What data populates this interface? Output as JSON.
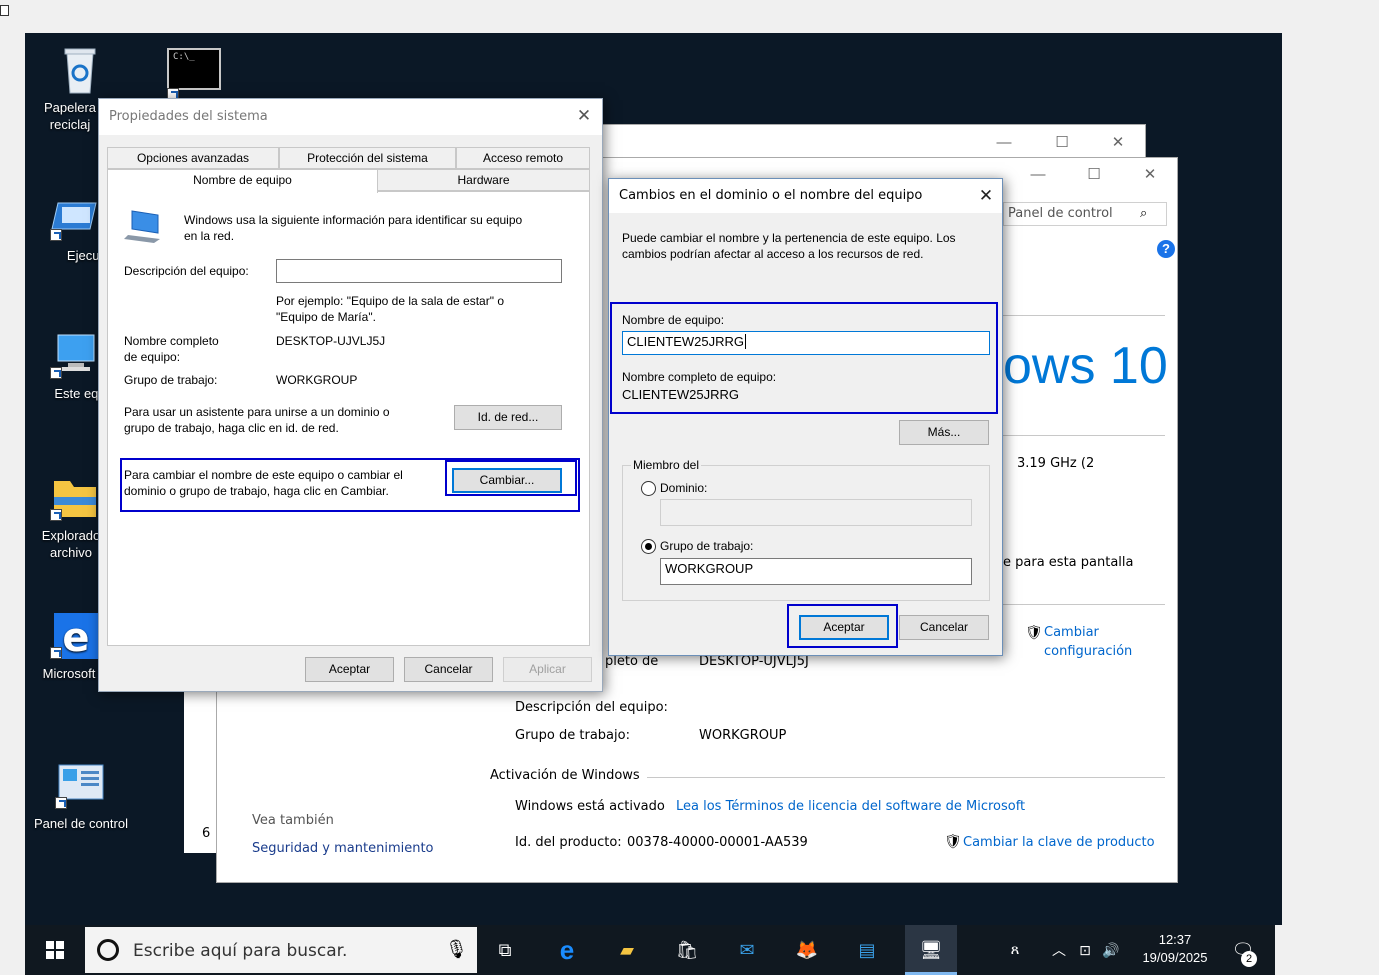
{
  "desktop": {
    "icons": [
      {
        "label": "Papelera de reciclaje",
        "line1": "Papelera",
        "line2": "reciclaj"
      },
      {
        "label": "Ejecutar",
        "line1": "Ejecut",
        "line2": ""
      },
      {
        "label": "Este equipo",
        "line1": "Este equ",
        "line2": ""
      },
      {
        "label": "Explorador de archivos",
        "line1": "Explorado",
        "line2": "archivo"
      },
      {
        "label": "Microsoft Edge",
        "line1": "Microsoft",
        "line2": ""
      },
      {
        "label": "Panel de control",
        "line1": "Panel de control",
        "line2": ""
      }
    ]
  },
  "sysinfo": {
    "search_placeholder": "Panel de control",
    "brand_text": "ows 10",
    "processor_fragment": "3.19 GHz  (2",
    "display_fragment": "e para esta pantalla",
    "change_settings": "Cambiar configuración",
    "change_settings_l1": "Cambiar",
    "change_settings_l2": "configuración",
    "full_name_label_fragment": "pleto de",
    "full_name_value": "DESKTOP-UJVLJ5J",
    "desc_label": "Descripción del equipo:",
    "workgroup_label": "Grupo de trabajo:",
    "workgroup_value": "WORKGROUP",
    "activation_header": "Activación de Windows",
    "activated_text": "Windows está activado",
    "license_link": "Lea los Términos de licencia del software de Microsoft",
    "product_id_label": "Id. del producto:",
    "product_id_value": "00378-40000-00001-AA539",
    "change_key": "Cambiar la clave de producto",
    "see_also": "Vea también",
    "security": "Seguridad y mantenimiento",
    "left_frag": "6"
  },
  "props": {
    "title": "Propiedades del sistema",
    "tabs_row1": [
      "Opciones avanzadas",
      "Protección del sistema",
      "Acceso remoto"
    ],
    "tabs_row2": [
      "Nombre de equipo",
      "Hardware"
    ],
    "intro_l1": "Windows usa la siguiente información para identificar su equipo",
    "intro_l2": "en la red.",
    "desc_label": "Descripción del equipo:",
    "desc_value": "",
    "example_l1": "Por ejemplo: \"Equipo de la sala de estar\" o",
    "example_l2": "\"Equipo de María\".",
    "full_name_l1": "Nombre completo",
    "full_name_l2": "de equipo:",
    "full_name_value": "DESKTOP-UJVLJ5J",
    "workgroup_label": "Grupo de trabajo:",
    "workgroup_value": "WORKGROUP",
    "netid_l1": "Para usar un asistente para unirse a un dominio o",
    "netid_l2": "grupo de trabajo, haga clic en id. de red.",
    "netid_button": "Id. de red...",
    "change_l1": "Para cambiar el nombre de este equipo o cambiar el",
    "change_l2": "dominio o grupo de trabajo, haga clic en Cambiar.",
    "change_button": "Cambiar...",
    "ok": "Aceptar",
    "cancel": "Cancelar",
    "apply": "Aplicar"
  },
  "dialog": {
    "title": "Cambios en el dominio o el nombre del equipo",
    "intro_l1": "Puede cambiar el nombre y la pertenencia de este equipo. Los",
    "intro_l2": "cambios podrían afectar al acceso a los recursos de red.",
    "name_label": "Nombre de equipo:",
    "name_value": "CLIENTEW25JRRG",
    "full_label": "Nombre completo de equipo:",
    "full_value": "CLIENTEW25JRRG",
    "more_button": "Más...",
    "member_of": "Miembro del",
    "domain_label": "Dominio:",
    "domain_value": "",
    "workgroup_label": "Grupo de trabajo:",
    "workgroup_value": "WORKGROUP",
    "ok": "Aceptar",
    "cancel": "Cancelar"
  },
  "taskbar": {
    "search_placeholder": "Escribe aquí para buscar.",
    "time": "12:37",
    "date": "19/09/2025",
    "notifications": "2"
  }
}
